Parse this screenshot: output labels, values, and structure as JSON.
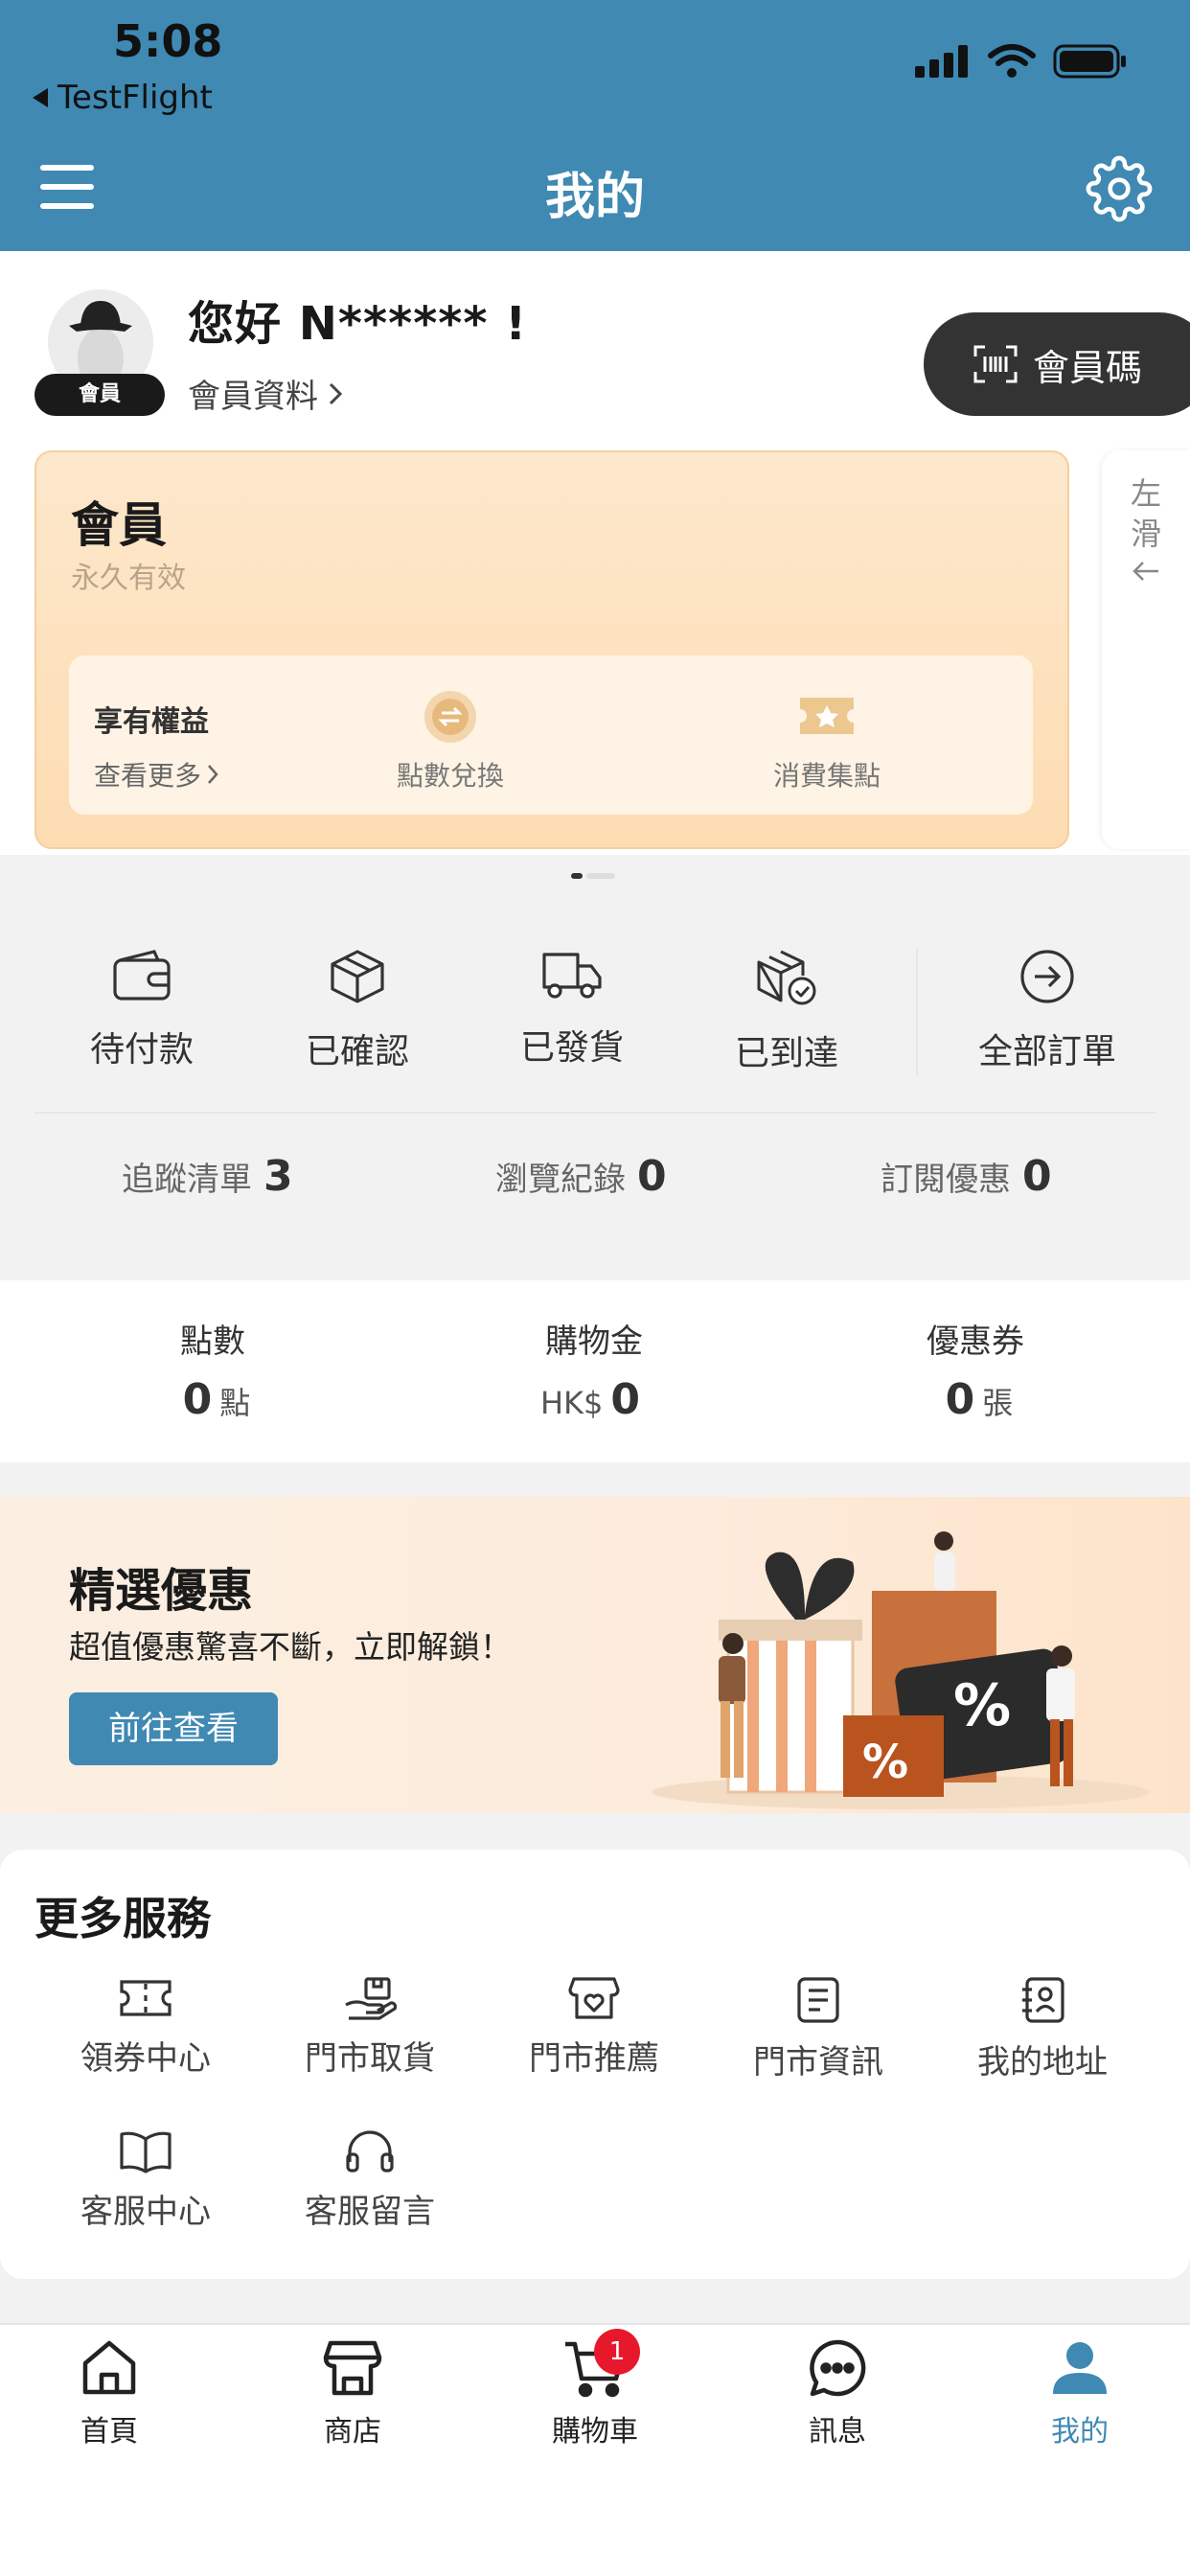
{
  "status_bar": {
    "time": "5:08",
    "back_app": "TestFlight"
  },
  "header": {
    "title": "我的"
  },
  "profile": {
    "greeting": "您好 N****** !",
    "member_tag": "會員",
    "profile_link": "會員資料",
    "member_code_button": "會員碼"
  },
  "member_card": {
    "title": "會員",
    "validity": "永久有效",
    "benefits_title": "享有權益",
    "benefits_more": "查看更多",
    "benefit_items": [
      "點數兌換",
      "消費集點"
    ],
    "swipe_hint": "左滑"
  },
  "orders": {
    "items": [
      "待付款",
      "已確認",
      "已發貨",
      "已到達",
      "全部訂單"
    ]
  },
  "stats": [
    {
      "label": "追蹤清單",
      "value": "3"
    },
    {
      "label": "瀏覽紀錄",
      "value": "0"
    },
    {
      "label": "訂閱優惠",
      "value": "0"
    }
  ],
  "wallet": [
    {
      "label": "點數",
      "prefix": "",
      "value": "0",
      "suffix": "點"
    },
    {
      "label": "購物金",
      "prefix": "HK$",
      "value": "0",
      "suffix": ""
    },
    {
      "label": "優惠券",
      "prefix": "",
      "value": "0",
      "suffix": "張"
    }
  ],
  "promo": {
    "title": "精選優惠",
    "subtitle": "超值優惠驚喜不斷，立即解鎖！",
    "button": "前往查看",
    "art_text": "%"
  },
  "services": {
    "title": "更多服務",
    "items": [
      "領券中心",
      "門市取貨",
      "門市推薦",
      "門市資訊",
      "我的地址",
      "客服中心",
      "客服留言"
    ]
  },
  "tabbar": {
    "items": [
      "首頁",
      "商店",
      "購物車",
      "訊息",
      "我的"
    ],
    "cart_badge": "1",
    "active_color": "#3f89b3"
  },
  "colors": {
    "brand": "#3f89b3",
    "badge": "#e8182c"
  }
}
